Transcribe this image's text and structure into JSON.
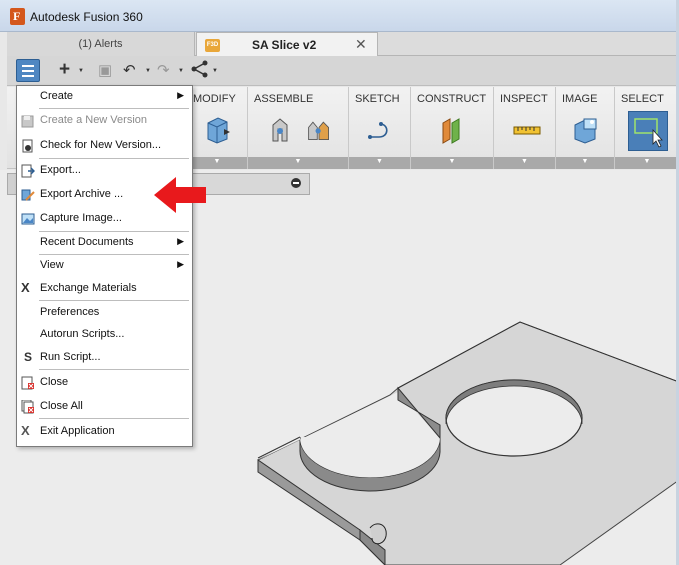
{
  "window": {
    "title": "Autodesk Fusion 360",
    "app_icon": "fusion-app-icon"
  },
  "tabs": [
    {
      "label": "(1) Alerts"
    },
    {
      "label": "SA Slice v2",
      "badge": "F3D",
      "close": "✕"
    }
  ],
  "ribbon": {
    "groups": [
      {
        "label": "MODIFY"
      },
      {
        "label": "ASSEMBLE"
      },
      {
        "label": "SKETCH"
      },
      {
        "label": "CONSTRUCT"
      },
      {
        "label": "INSPECT"
      },
      {
        "label": "IMAGE"
      },
      {
        "label": "SELECT"
      }
    ]
  },
  "menu": {
    "items": [
      {
        "label": "Create",
        "submenu": true
      },
      {
        "label": "Create a New Version",
        "disabled": true,
        "icon": "save-version-icon"
      },
      {
        "label": "Check for New Version...",
        "icon": "check-version-icon"
      },
      {
        "label": "Export...",
        "icon": "export-icon"
      },
      {
        "label": "Export Archive ...",
        "icon": "export-archive-icon"
      },
      {
        "label": "Capture Image...",
        "icon": "capture-image-icon"
      },
      {
        "label": "Recent Documents",
        "submenu": true
      },
      {
        "label": "View",
        "submenu": true
      },
      {
        "label": "Exchange Materials",
        "icon": "exchange-materials-icon"
      },
      {
        "label": "Preferences"
      },
      {
        "label": "Autorun Scripts..."
      },
      {
        "label": "Run Script...",
        "icon": "script-icon"
      },
      {
        "label": "Close",
        "icon": "close-doc-icon"
      },
      {
        "label": "Close All",
        "icon": "close-all-icon"
      },
      {
        "label": "Exit Application",
        "icon": "exit-icon"
      }
    ]
  },
  "colors": {
    "highlight_arrow": "#e8191c",
    "menu_button": "#4f87c2",
    "select_active": "#4a7fb8"
  }
}
